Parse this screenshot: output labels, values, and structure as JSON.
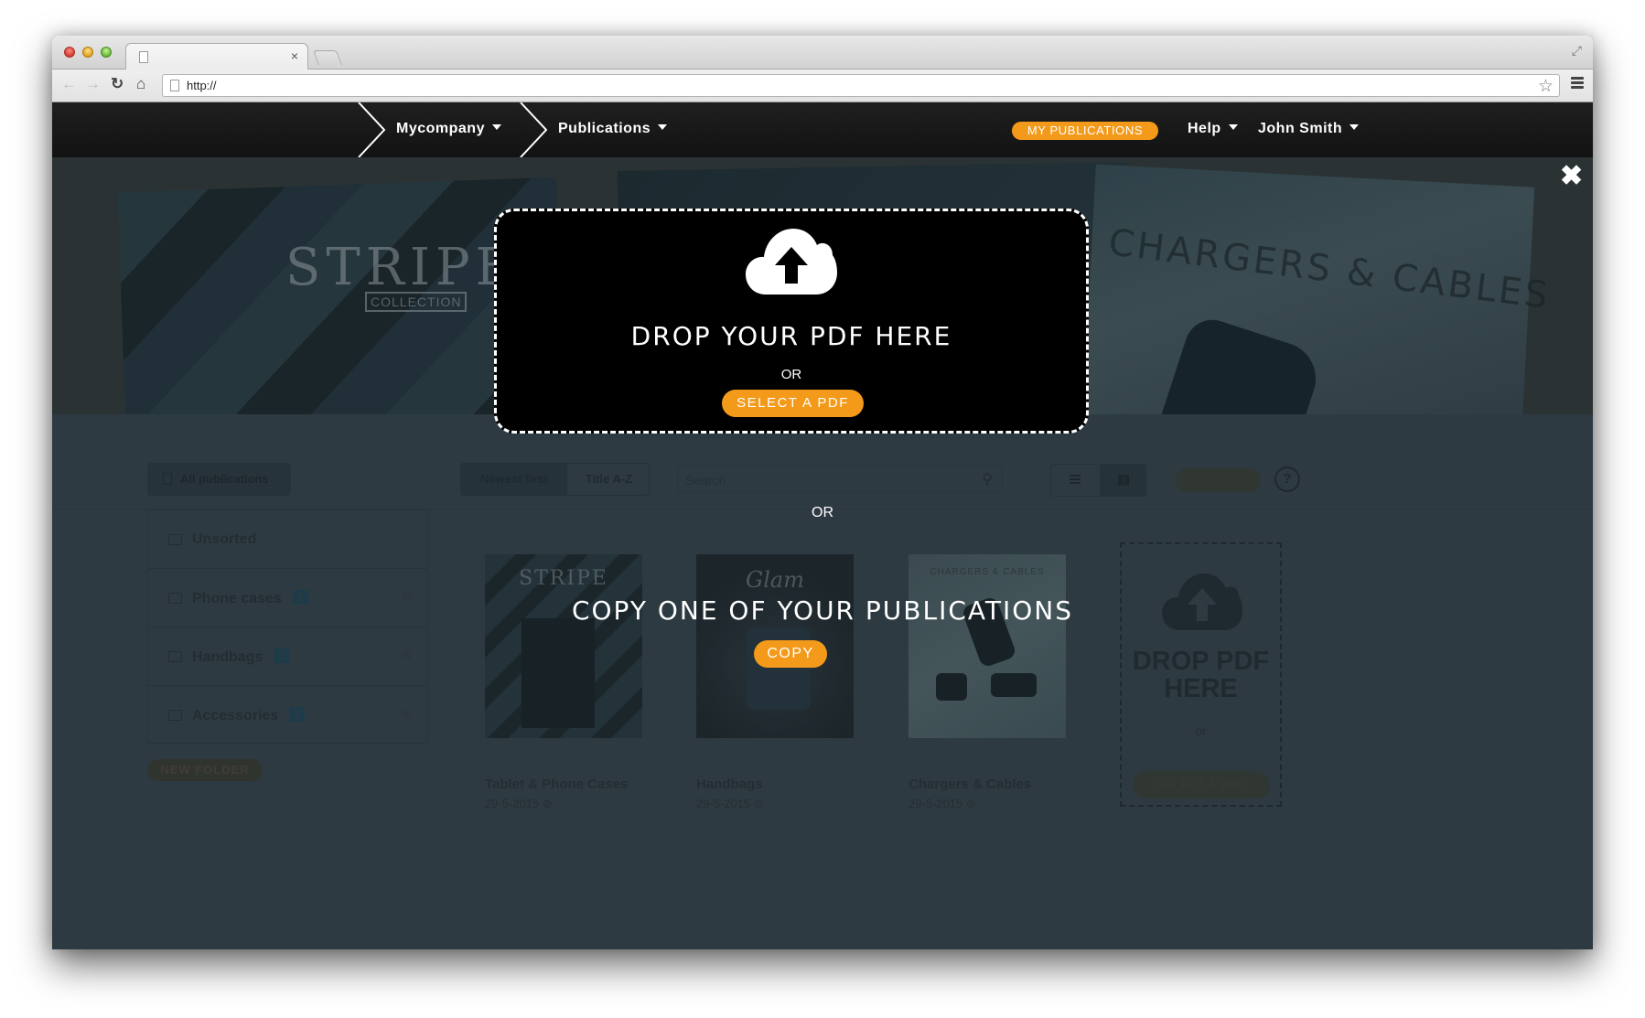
{
  "browser": {
    "tab_title": "",
    "tab_close": "×",
    "url": "http://",
    "back_icon": "←",
    "forward_icon": "→",
    "reload_icon": "↻",
    "home_icon": "⌂",
    "star_icon": "☆",
    "fullscreen_icon": "⤢"
  },
  "nav": {
    "breadcrumbs": [
      {
        "label": "Mycompany"
      },
      {
        "label": "Publications"
      }
    ],
    "my_publications": "MY PUBLICATIONS",
    "help": "Help",
    "user": "John Smith"
  },
  "colors": {
    "accent": "#f39a1b",
    "nav_bg": "#1a1a1a",
    "page_bg": "#2e3a41",
    "dropzone_bg": "#000000"
  },
  "hero": {
    "stripe_title": "STRIPE",
    "stripe_subtitle": "COLLECTION",
    "chargers_title": "CHARGERS & CABLES"
  },
  "toolbar": {
    "all_publications": "All publications",
    "sort_newest": "Newest first",
    "sort_title": "Title A-Z",
    "search_placeholder": "Search",
    "action_button": "",
    "help_icon": "?"
  },
  "folders": [
    {
      "name": "Unsorted",
      "count": ""
    },
    {
      "name": "Phone cases",
      "count": "1"
    },
    {
      "name": "Handbags",
      "count": "1"
    },
    {
      "name": "Accessories",
      "count": "1"
    }
  ],
  "new_folder": "NEW FOLDER",
  "publications": [
    {
      "title": "Tablet & Phone Cases",
      "date": "29-5-2015",
      "cover_text": "STRIPE"
    },
    {
      "title": "Handbags",
      "date": "29-5-2015",
      "cover_text": "Glam"
    },
    {
      "title": "Chargers & Cables",
      "date": "29-5-2015",
      "cover_text": "CHARGERS & CABLES"
    }
  ],
  "upload_card": {
    "title": "DROP PDF HERE",
    "or": "or",
    "button": "SELECT A PDF"
  },
  "overlay": {
    "close_icon": "✖",
    "drop_title": "DROP YOUR PDF HERE",
    "or_1": "OR",
    "select_button": "SELECT A PDF",
    "or_2": "OR",
    "copy_title": "COPY ONE OF YOUR PUBLICATIONS",
    "copy_button": "COPY"
  }
}
